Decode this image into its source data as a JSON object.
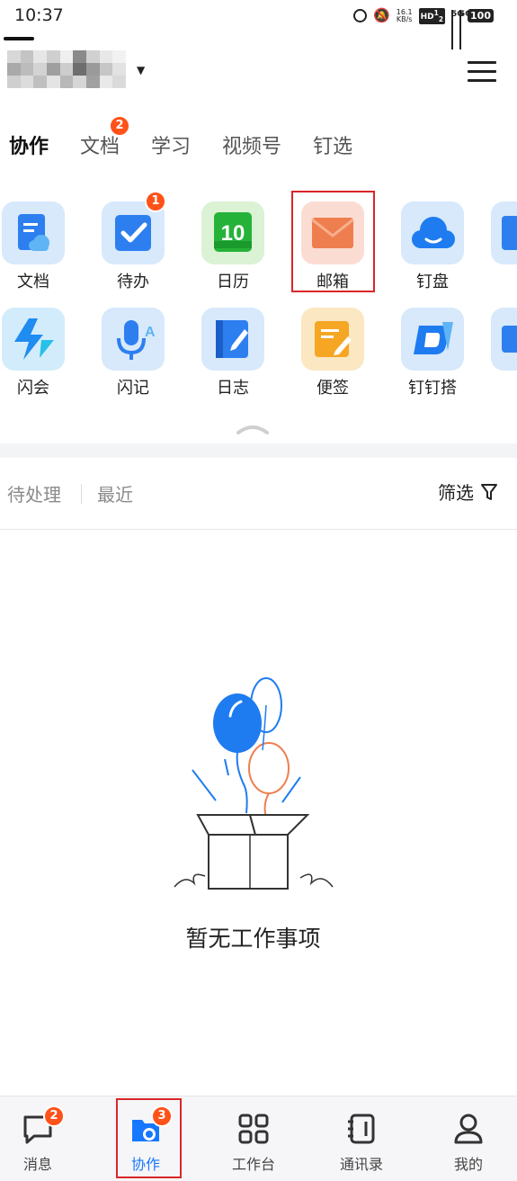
{
  "status_bar": {
    "time": "10:37",
    "speed_value": "16.1",
    "speed_unit": "KB/s",
    "hd_label": "HD",
    "sim1": "1",
    "sim2": "2",
    "network1": "5G",
    "network2": "5G",
    "battery": "100"
  },
  "header": {
    "org_name_redacted": true
  },
  "tabs": [
    {
      "label": "协作",
      "active": true
    },
    {
      "label": "文档",
      "badge": "2"
    },
    {
      "label": "学习"
    },
    {
      "label": "视频号"
    },
    {
      "label": "钉选"
    }
  ],
  "apps_row1": [
    {
      "label": "文档",
      "icon": "doc-icon"
    },
    {
      "label": "待办",
      "icon": "todo-icon",
      "badge": "1"
    },
    {
      "label": "日历",
      "icon": "calendar-icon",
      "calendar_day": "10"
    },
    {
      "label": "邮箱",
      "icon": "mail-icon"
    },
    {
      "label": "钉盘",
      "icon": "cloud-drive-icon"
    }
  ],
  "apps_row2": [
    {
      "label": "闪会",
      "icon": "flash-meeting-icon"
    },
    {
      "label": "闪记",
      "icon": "flash-note-icon"
    },
    {
      "label": "日志",
      "icon": "log-icon"
    },
    {
      "label": "便签",
      "icon": "sticky-note-icon"
    },
    {
      "label": "钉钉搭",
      "icon": "dingtalk-builder-icon"
    }
  ],
  "filter_bar": {
    "tab_pending": "待处理",
    "tab_recent": "最近",
    "filter_label": "筛选"
  },
  "empty_state": {
    "text": "暂无工作事项"
  },
  "bottom_nav": [
    {
      "label": "消息",
      "icon": "chat-icon",
      "badge": "2"
    },
    {
      "label": "协作",
      "icon": "collab-icon",
      "badge": "3",
      "active": true
    },
    {
      "label": "工作台",
      "icon": "workbench-icon"
    },
    {
      "label": "通讯录",
      "icon": "contacts-icon"
    },
    {
      "label": "我的",
      "icon": "profile-icon"
    }
  ],
  "colors": {
    "accent": "#1677ff",
    "badge": "#ff5219",
    "highlight": "#d9262a"
  }
}
